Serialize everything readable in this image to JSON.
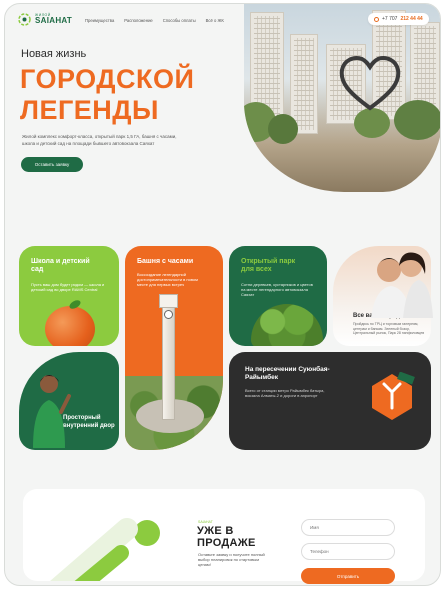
{
  "header": {
    "logo_small": "ЖИЛОЙ",
    "logo_big": "SAIAHAT",
    "nav": [
      "Преимущества",
      "Расположение",
      "Способы оплаты",
      "Всё о ЖК"
    ],
    "phone_prefix": "+7 707",
    "phone_number": "212 44 44"
  },
  "hero": {
    "subtitle": "Новая жизнь",
    "title_line1": "ГОРОДСКОЙ",
    "title_line2": "ЛЕГЕНДЫ",
    "description": "Жилой комплекс комфорт-класса, открытый парк 1,5 ГА, башня с часами, школа и детский сад на площади бывшего автовокзала Саяхат",
    "cta_label": "Оставить заявку"
  },
  "features": {
    "school": {
      "title": "Школа и детский сад",
      "text": "Пусть ваш дом будет рядом — школа и детский сад во дворе RAMS Central"
    },
    "tower": {
      "title": "Башня с часами",
      "text": "Воссоздание легендарной достопримечательности в новом месте для первых встреч"
    },
    "park": {
      "title": "Открытый парк для всех",
      "text": "Сотни деревьев, кустарников и цветов на месте легендарного автовокзала Саяхат"
    },
    "near": {
      "title": "Все важное рядом",
      "text": "Пройдись по ТРЦ и торговым галереям, центрам и банкам. Зеленый бозор, Центральный рынок, Парк 28 панфиловцев"
    },
    "yard": {
      "title": "Просторный внутренний двор"
    },
    "metro": {
      "title": "На пересечении Суюнбая-Райымбек",
      "text": "Всего от станции метро Райымбек батыра, вокзала Алматы-2 и дороги в аэропорт"
    }
  },
  "sale": {
    "tag": "SAIAHAT",
    "title_line1": "УЖЕ В",
    "title_line2": "ПРОДАЖЕ",
    "text": "Оставьте заявку и получите полный выбор планировок по стартовым ценам!",
    "name_placeholder": "Имя",
    "phone_placeholder": "Телефон",
    "submit_label": "Отправить"
  },
  "colors": {
    "accent_orange": "#ee6a21",
    "accent_green": "#8ccb3f",
    "brand_dark_green": "#1f6b45",
    "charcoal": "#2d2d2d"
  }
}
